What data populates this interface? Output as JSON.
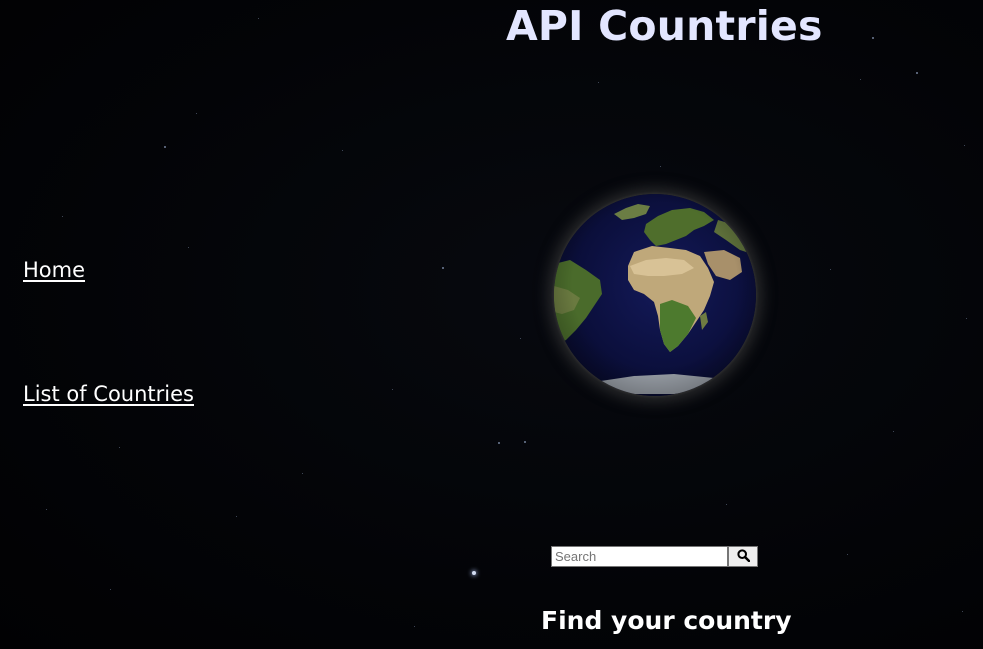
{
  "header": {
    "title": "API Countries"
  },
  "nav": {
    "items": [
      {
        "label": "Home"
      },
      {
        "label": "List of Countries"
      }
    ]
  },
  "hero": {
    "image": "earth-globe"
  },
  "search": {
    "placeholder": "Search",
    "value": "",
    "button_icon": "magnifier-icon"
  },
  "footer": {
    "heading": "Find your country"
  },
  "colors": {
    "background": "#030407",
    "title": "#e3e6ff",
    "text": "#ffffff"
  }
}
